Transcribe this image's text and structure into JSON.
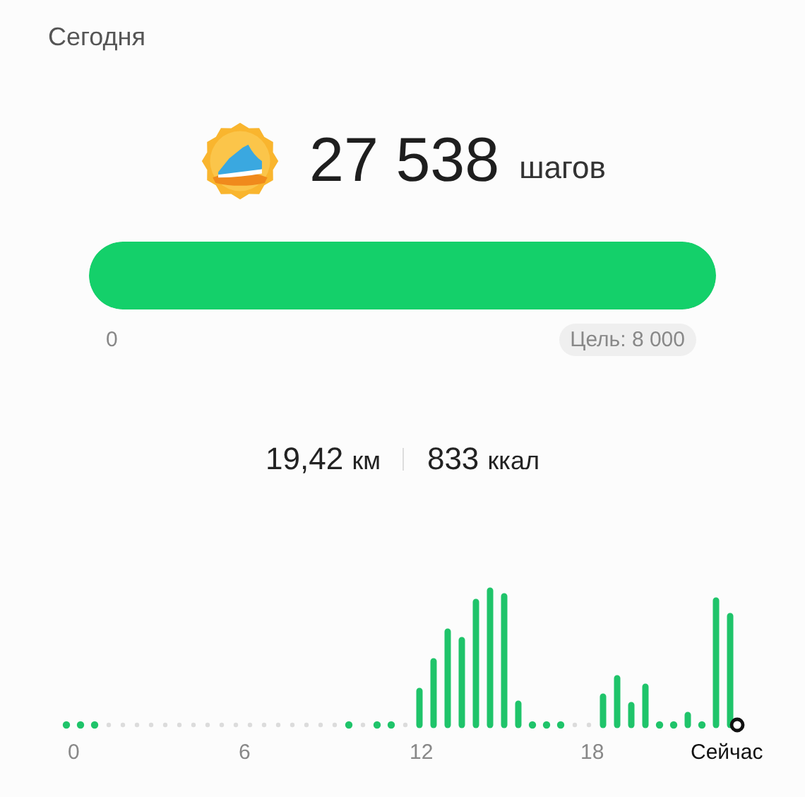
{
  "header": {
    "title": "Сегодня"
  },
  "steps": {
    "value": "27 538",
    "unit": "шагов"
  },
  "progress": {
    "level": 1,
    "min_label": "0",
    "goal_label": "Цель: 8 000"
  },
  "stats": [
    {
      "value": "19,42",
      "unit": "км"
    },
    {
      "value": "833",
      "unit": "ккал"
    }
  ],
  "timeline": {
    "axis_labels": [
      "0",
      "6",
      "12",
      "18"
    ],
    "now_label": "Сейчас"
  }
}
